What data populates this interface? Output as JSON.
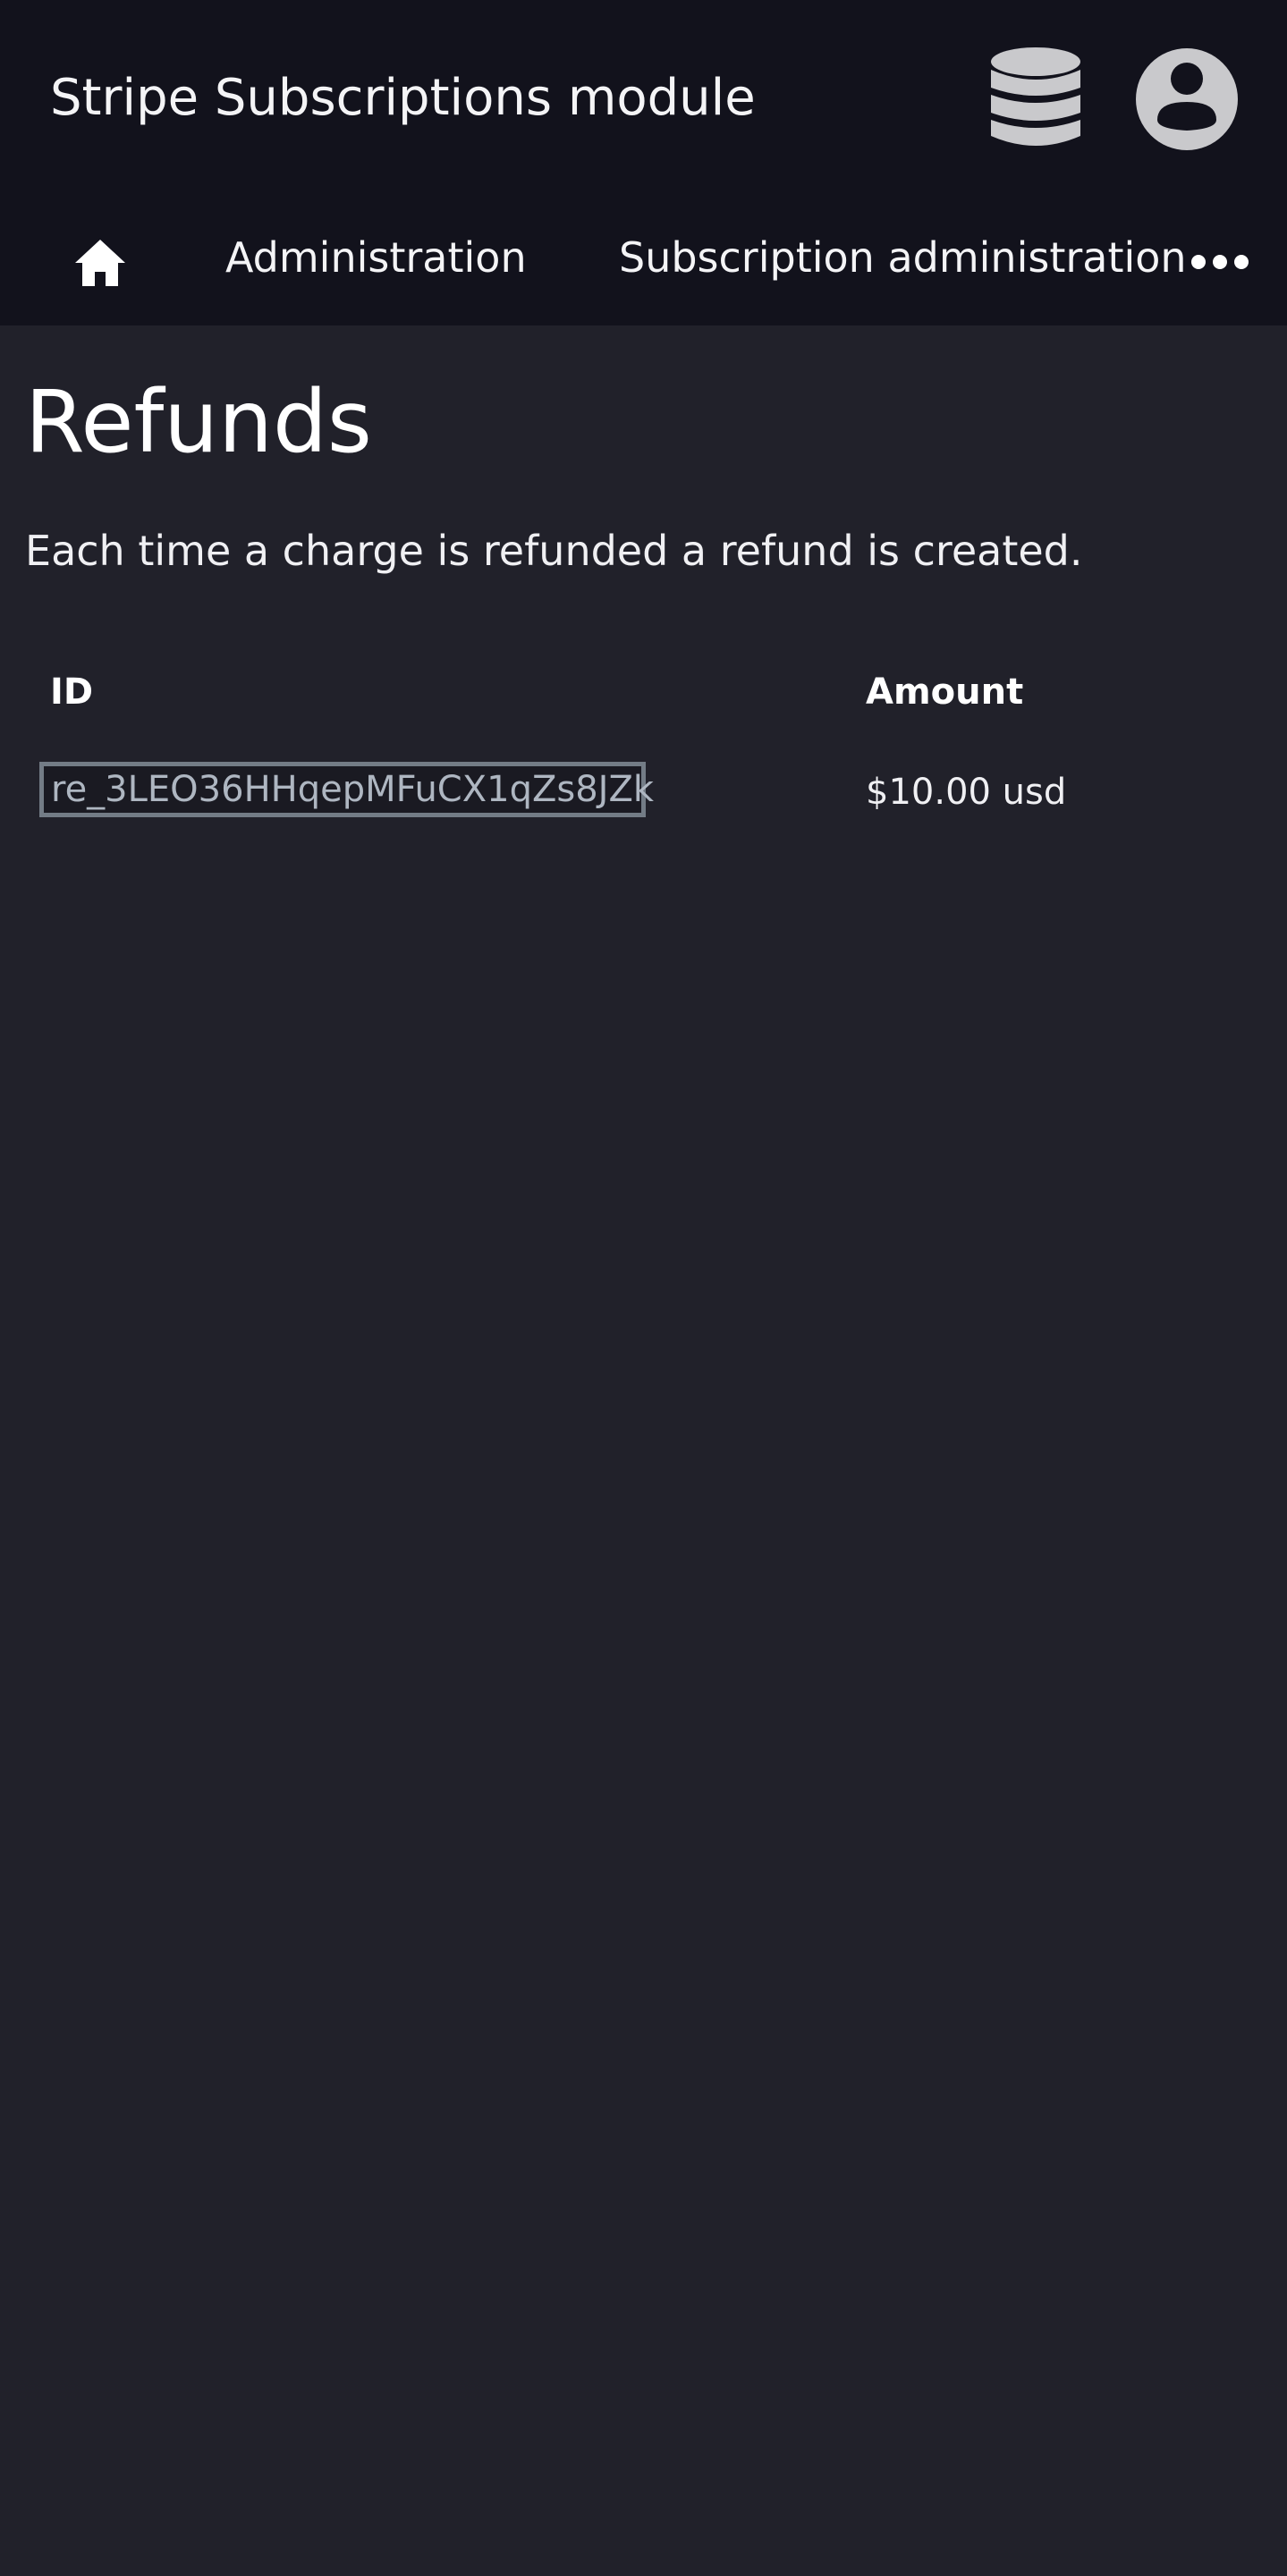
{
  "header": {
    "app_title": "Stripe Subscriptions module",
    "icons": {
      "database": "database-icon",
      "account": "user-circle-icon"
    }
  },
  "nav": {
    "home_icon": "home-icon",
    "items": [
      {
        "label": "Administration"
      },
      {
        "label": "Subscription administration"
      }
    ],
    "more_icon": "ellipsis-icon"
  },
  "main": {
    "title": "Refunds",
    "description": "Each time a charge is refunded a refund is created.",
    "table": {
      "columns": [
        "ID",
        "Amount"
      ],
      "rows": [
        {
          "id": "re_3LEO36HHqepMFuCX1qZs8JZk",
          "amount": "$10.00 usd"
        }
      ]
    }
  },
  "colors": {
    "header_bg": "#12121c",
    "page_bg": "#21212a",
    "text": "#ffffff",
    "link_muted": "#aeb6c1",
    "focus_border": "#737c86",
    "icon_gray": "#c9c9cc"
  }
}
